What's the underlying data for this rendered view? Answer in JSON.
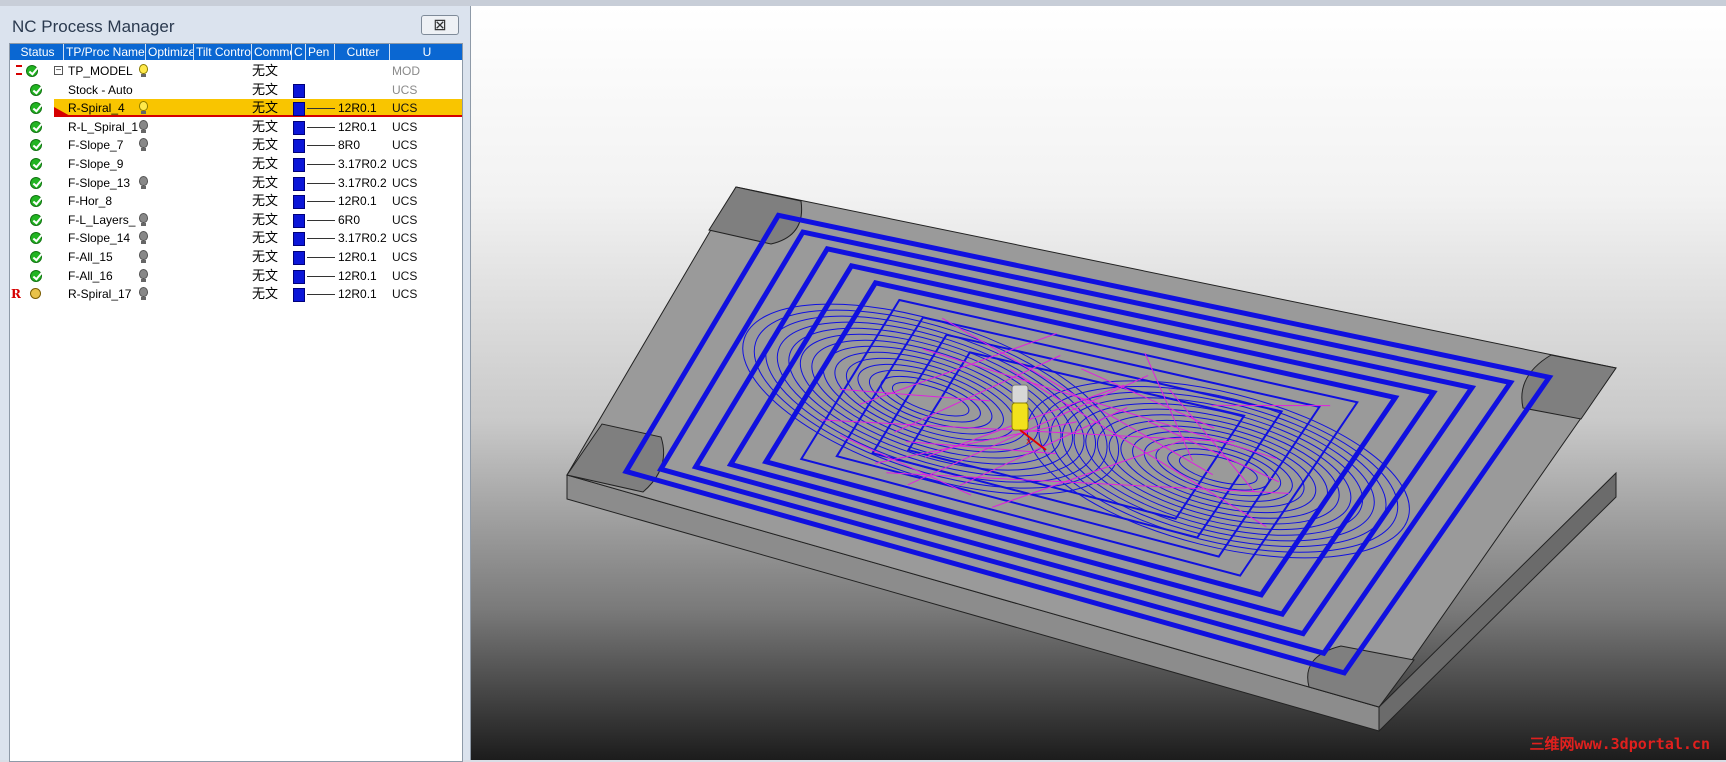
{
  "panel": {
    "title": "NC Process Manager",
    "close_glyph": "⊠"
  },
  "columns": [
    "Status",
    "TP/Proc Name",
    "Optimize",
    "Tilt Control",
    "Comment",
    "C",
    "Pen",
    "Cutter",
    "U"
  ],
  "rows": [
    {
      "name": "TP_MODEL",
      "comment": "无文",
      "cutter": "",
      "ucs": "MOD",
      "status": "model",
      "bulb": "on",
      "tree": "⊟",
      "pen": false
    },
    {
      "name": "Stock - Auto",
      "comment": "无文",
      "cutter": "",
      "ucs": "UCS",
      "status": "ok",
      "bulb": "",
      "pen": true,
      "pen_line": false
    },
    {
      "name": "R-Spiral_4",
      "comment": "无文",
      "cutter": "12R0.1",
      "ucs": "UCS",
      "status": "ok",
      "bulb": "on",
      "pen": true,
      "selected": true
    },
    {
      "name": "R-L_Spiral_1",
      "comment": "无文",
      "cutter": "12R0.1",
      "ucs": "UCS",
      "status": "ok",
      "bulb": "off",
      "pen": true
    },
    {
      "name": "F-Slope_7",
      "comment": "无文",
      "cutter": "8R0",
      "ucs": "UCS",
      "status": "ok",
      "bulb": "off",
      "pen": true
    },
    {
      "name": "F-Slope_9",
      "comment": "无文",
      "cutter": "3.17R0.2",
      "ucs": "UCS",
      "status": "ok",
      "bulb": "",
      "pen": true
    },
    {
      "name": "F-Slope_13",
      "comment": "无文",
      "cutter": "3.17R0.2",
      "ucs": "UCS",
      "status": "ok",
      "bulb": "off",
      "pen": true
    },
    {
      "name": "F-Hor_8",
      "comment": "无文",
      "cutter": "12R0.1",
      "ucs": "UCS",
      "status": "ok",
      "bulb": "",
      "pen": true
    },
    {
      "name": "F-L_Layers_",
      "comment": "无文",
      "cutter": "6R0",
      "ucs": "UCS",
      "status": "ok",
      "bulb": "off",
      "pen": true
    },
    {
      "name": "F-Slope_14",
      "comment": "无文",
      "cutter": "3.17R0.2",
      "ucs": "UCS",
      "status": "ok",
      "bulb": "off",
      "pen": true
    },
    {
      "name": "F-All_15",
      "comment": "无文",
      "cutter": "12R0.1",
      "ucs": "UCS",
      "status": "ok",
      "bulb": "off",
      "pen": true
    },
    {
      "name": "F-All_16",
      "comment": "无文",
      "cutter": "12R0.1",
      "ucs": "UCS",
      "status": "ok",
      "bulb": "off",
      "pen": true
    },
    {
      "name": "R-Spiral_17",
      "comment": "无文",
      "cutter": "12R0.1",
      "ucs": "UCS",
      "status": "pending",
      "status_mark": "R",
      "bulb": "off",
      "pen": true
    }
  ],
  "colors": {
    "header_bg": "#0a67d2",
    "selected_bg": "#f9c500",
    "toolpath": "#1010e0",
    "rapid": "#e020e0",
    "pen": "#0b16d8"
  },
  "watermark": "三维网www.3dportal.cn"
}
